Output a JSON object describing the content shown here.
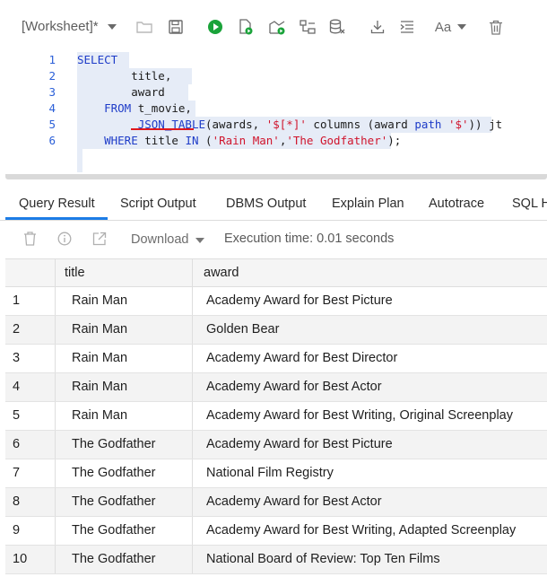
{
  "worksheet": {
    "title": "[Worksheet]*"
  },
  "toolbar": {
    "icons": [
      "open-folder-icon",
      "save-icon",
      "run-statement-icon",
      "run-script-icon",
      "explain-plan-icon",
      "autotrace-icon",
      "database-icon",
      "download-icon",
      "format-icon",
      "text-case-icon",
      "clear-icon"
    ],
    "run_color": "#1aa33a"
  },
  "editor": {
    "line_numbers": [
      "1",
      "2",
      "3",
      "4",
      "5",
      "6"
    ],
    "lines": [
      {
        "parts": [
          {
            "t": "SELECT",
            "c": "kw"
          }
        ]
      },
      {
        "parts": [
          {
            "t": "        title,",
            "c": ""
          }
        ]
      },
      {
        "parts": [
          {
            "t": "        award",
            "c": ""
          }
        ]
      },
      {
        "parts": [
          {
            "t": "    ",
            "c": ""
          },
          {
            "t": "FROM",
            "c": "kw"
          },
          {
            "t": " t_movie,",
            "c": ""
          }
        ]
      },
      {
        "parts": [
          {
            "t": "         ",
            "c": ""
          },
          {
            "t": "JSON_TABLE",
            "c": "fn"
          },
          {
            "t": "(awards, ",
            "c": ""
          },
          {
            "t": "'$[*]'",
            "c": "str"
          },
          {
            "t": " columns (award ",
            "c": ""
          },
          {
            "t": "path",
            "c": "kw"
          },
          {
            "t": " ",
            "c": ""
          },
          {
            "t": "'$'",
            "c": "str"
          },
          {
            "t": ")) jt",
            "c": ""
          }
        ]
      },
      {
        "parts": [
          {
            "t": "    ",
            "c": ""
          },
          {
            "t": "WHERE",
            "c": "kw"
          },
          {
            "t": " title ",
            "c": ""
          },
          {
            "t": "IN",
            "c": "kw"
          },
          {
            "t": " (",
            "c": ""
          },
          {
            "t": "'Rain Man'",
            "c": "str"
          },
          {
            "t": ",",
            "c": ""
          },
          {
            "t": "'The Godfather'",
            "c": "str"
          },
          {
            "t": ");",
            "c": ""
          }
        ]
      }
    ]
  },
  "tabs": [
    {
      "label": "Query Result",
      "active": true
    },
    {
      "label": "Script Output"
    },
    {
      "label": "DBMS Output"
    },
    {
      "label": "Explain Plan"
    },
    {
      "label": "Autotrace"
    },
    {
      "label": "SQL H"
    }
  ],
  "result_toolbar": {
    "download_label": "Download",
    "execution_time": "Execution time: 0.01 seconds"
  },
  "grid": {
    "columns": [
      "title",
      "award"
    ],
    "rows": [
      {
        "num": "1",
        "title": "Rain Man",
        "award": "Academy Award for Best Picture"
      },
      {
        "num": "2",
        "title": "Rain Man",
        "award": "Golden Bear"
      },
      {
        "num": "3",
        "title": "Rain Man",
        "award": "Academy Award for Best Director"
      },
      {
        "num": "4",
        "title": "Rain Man",
        "award": "Academy Award for Best Actor"
      },
      {
        "num": "5",
        "title": "Rain Man",
        "award": "Academy Award for Best Writing, Original Screenplay"
      },
      {
        "num": "6",
        "title": "The Godfather",
        "award": "Academy Award for Best Picture"
      },
      {
        "num": "7",
        "title": "The Godfather",
        "award": "National Film Registry"
      },
      {
        "num": "8",
        "title": "The Godfather",
        "award": "Academy Award for Best Actor"
      },
      {
        "num": "9",
        "title": "The Godfather",
        "award": "Academy Award for Best Writing, Adapted Screenplay"
      },
      {
        "num": "10",
        "title": "The Godfather",
        "award": "National Board of Review: Top Ten Films"
      }
    ]
  }
}
